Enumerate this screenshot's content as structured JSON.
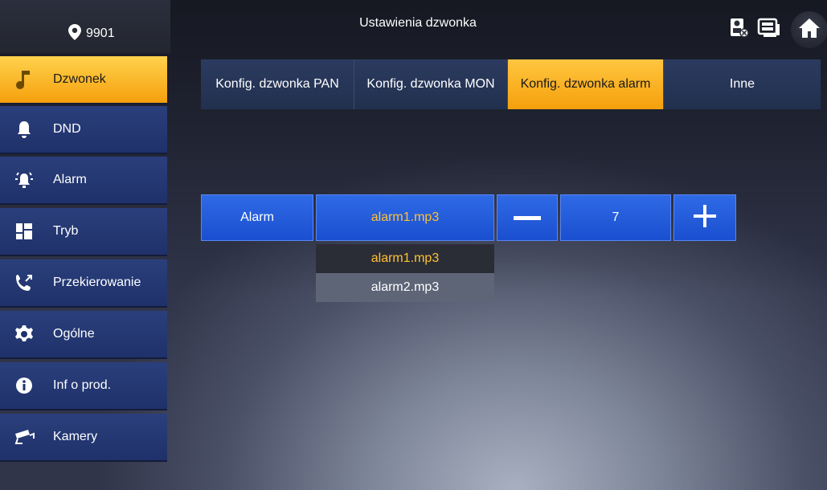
{
  "header": {
    "location": "9901",
    "title": "Ustawienia dzwonka"
  },
  "sidebar": {
    "items": [
      {
        "label": "Dzwonek",
        "icon": "music-note-icon",
        "active": true
      },
      {
        "label": "DND",
        "icon": "bell-icon",
        "active": false
      },
      {
        "label": "Alarm",
        "icon": "alarm-icon",
        "active": false
      },
      {
        "label": "Tryb",
        "icon": "grid-icon",
        "active": false
      },
      {
        "label": "Przekierowanie",
        "icon": "call-forward-icon",
        "active": false
      },
      {
        "label": "Ogólne",
        "icon": "gear-icon",
        "active": false
      },
      {
        "label": "Inf o prod.",
        "icon": "info-icon",
        "active": false
      },
      {
        "label": "Kamery",
        "icon": "camera-icon",
        "active": false
      }
    ]
  },
  "tabs": [
    {
      "label": "Konfig. dzwonka PAN",
      "active": false
    },
    {
      "label": "Konfig. dzwonka MON",
      "active": false
    },
    {
      "label": "Konfig. dzwonka alarm",
      "active": true
    },
    {
      "label": "Inne",
      "active": false
    }
  ],
  "control": {
    "label": "Alarm",
    "selected_file": "alarm1.mp3",
    "volume": "7",
    "minus_label": "—",
    "plus_label": "+"
  },
  "dropdown": {
    "options": [
      "alarm1.mp3",
      "alarm2.mp3"
    ],
    "selected": "alarm1.mp3"
  },
  "colors": {
    "accent": "#f5a00c",
    "button_blue": "#1a4fcf",
    "sidebar_blue": "#1f316a",
    "selected_text": "#ffc133"
  }
}
